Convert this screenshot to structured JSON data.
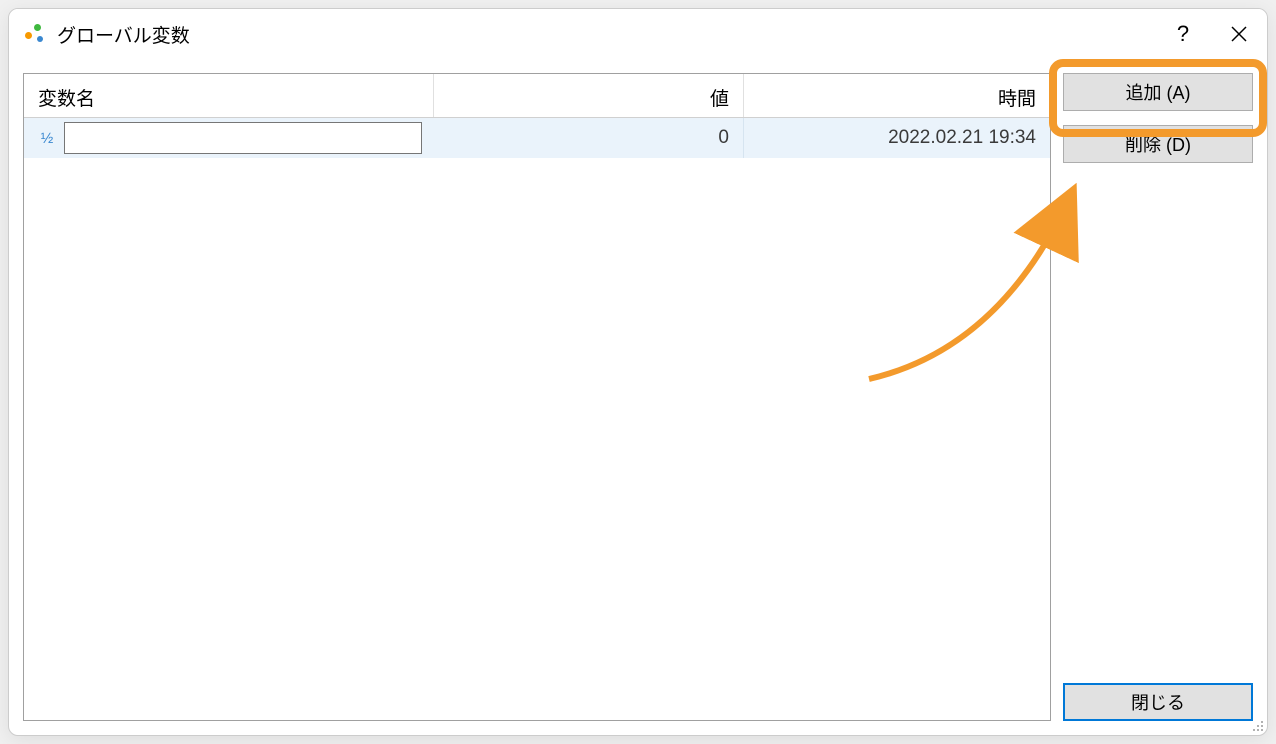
{
  "window": {
    "title": "グローバル変数"
  },
  "table": {
    "headers": {
      "name": "変数名",
      "value": "値",
      "time": "時間"
    },
    "rows": [
      {
        "icon": "½",
        "name": "",
        "value": "0",
        "time": "2022.02.21 19:34"
      }
    ]
  },
  "buttons": {
    "add": "追加 (A)",
    "delete": "削除 (D)",
    "close": "閉じる"
  }
}
